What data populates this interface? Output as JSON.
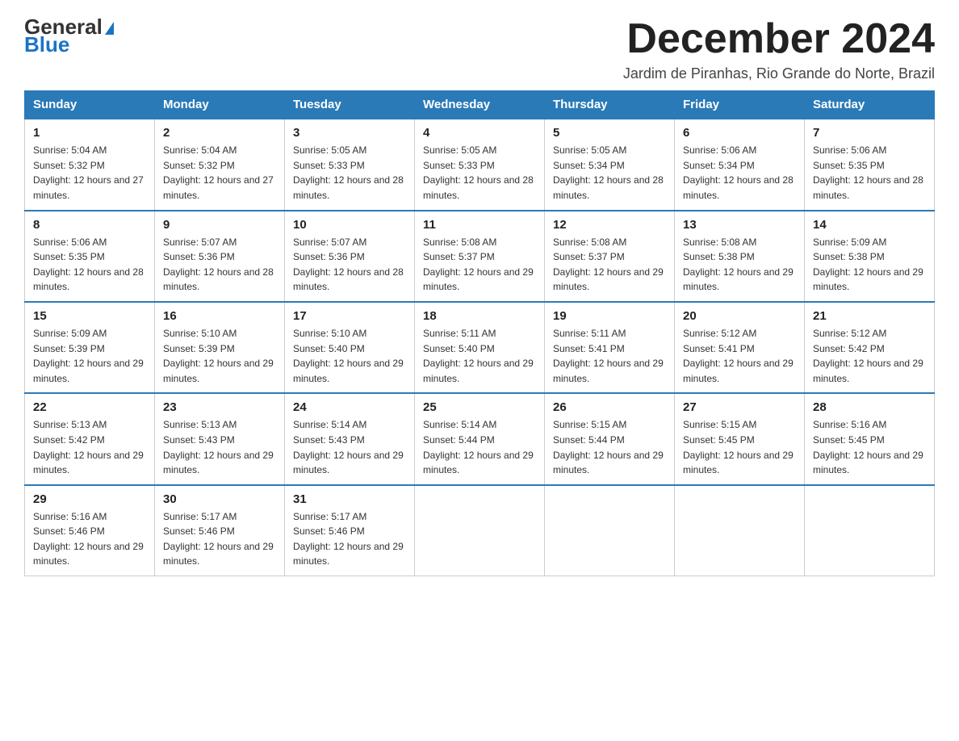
{
  "logo": {
    "general": "General",
    "blue": "Blue",
    "triangle": "▶"
  },
  "header": {
    "month_title": "December 2024",
    "location": "Jardim de Piranhas, Rio Grande do Norte, Brazil"
  },
  "days_of_week": [
    "Sunday",
    "Monday",
    "Tuesday",
    "Wednesday",
    "Thursday",
    "Friday",
    "Saturday"
  ],
  "weeks": [
    [
      {
        "day": "1",
        "sunrise": "5:04 AM",
        "sunset": "5:32 PM",
        "daylight": "12 hours and 27 minutes."
      },
      {
        "day": "2",
        "sunrise": "5:04 AM",
        "sunset": "5:32 PM",
        "daylight": "12 hours and 27 minutes."
      },
      {
        "day": "3",
        "sunrise": "5:05 AM",
        "sunset": "5:33 PM",
        "daylight": "12 hours and 28 minutes."
      },
      {
        "day": "4",
        "sunrise": "5:05 AM",
        "sunset": "5:33 PM",
        "daylight": "12 hours and 28 minutes."
      },
      {
        "day": "5",
        "sunrise": "5:05 AM",
        "sunset": "5:34 PM",
        "daylight": "12 hours and 28 minutes."
      },
      {
        "day": "6",
        "sunrise": "5:06 AM",
        "sunset": "5:34 PM",
        "daylight": "12 hours and 28 minutes."
      },
      {
        "day": "7",
        "sunrise": "5:06 AM",
        "sunset": "5:35 PM",
        "daylight": "12 hours and 28 minutes."
      }
    ],
    [
      {
        "day": "8",
        "sunrise": "5:06 AM",
        "sunset": "5:35 PM",
        "daylight": "12 hours and 28 minutes."
      },
      {
        "day": "9",
        "sunrise": "5:07 AM",
        "sunset": "5:36 PM",
        "daylight": "12 hours and 28 minutes."
      },
      {
        "day": "10",
        "sunrise": "5:07 AM",
        "sunset": "5:36 PM",
        "daylight": "12 hours and 28 minutes."
      },
      {
        "day": "11",
        "sunrise": "5:08 AM",
        "sunset": "5:37 PM",
        "daylight": "12 hours and 29 minutes."
      },
      {
        "day": "12",
        "sunrise": "5:08 AM",
        "sunset": "5:37 PM",
        "daylight": "12 hours and 29 minutes."
      },
      {
        "day": "13",
        "sunrise": "5:08 AM",
        "sunset": "5:38 PM",
        "daylight": "12 hours and 29 minutes."
      },
      {
        "day": "14",
        "sunrise": "5:09 AM",
        "sunset": "5:38 PM",
        "daylight": "12 hours and 29 minutes."
      }
    ],
    [
      {
        "day": "15",
        "sunrise": "5:09 AM",
        "sunset": "5:39 PM",
        "daylight": "12 hours and 29 minutes."
      },
      {
        "day": "16",
        "sunrise": "5:10 AM",
        "sunset": "5:39 PM",
        "daylight": "12 hours and 29 minutes."
      },
      {
        "day": "17",
        "sunrise": "5:10 AM",
        "sunset": "5:40 PM",
        "daylight": "12 hours and 29 minutes."
      },
      {
        "day": "18",
        "sunrise": "5:11 AM",
        "sunset": "5:40 PM",
        "daylight": "12 hours and 29 minutes."
      },
      {
        "day": "19",
        "sunrise": "5:11 AM",
        "sunset": "5:41 PM",
        "daylight": "12 hours and 29 minutes."
      },
      {
        "day": "20",
        "sunrise": "5:12 AM",
        "sunset": "5:41 PM",
        "daylight": "12 hours and 29 minutes."
      },
      {
        "day": "21",
        "sunrise": "5:12 AM",
        "sunset": "5:42 PM",
        "daylight": "12 hours and 29 minutes."
      }
    ],
    [
      {
        "day": "22",
        "sunrise": "5:13 AM",
        "sunset": "5:42 PM",
        "daylight": "12 hours and 29 minutes."
      },
      {
        "day": "23",
        "sunrise": "5:13 AM",
        "sunset": "5:43 PM",
        "daylight": "12 hours and 29 minutes."
      },
      {
        "day": "24",
        "sunrise": "5:14 AM",
        "sunset": "5:43 PM",
        "daylight": "12 hours and 29 minutes."
      },
      {
        "day": "25",
        "sunrise": "5:14 AM",
        "sunset": "5:44 PM",
        "daylight": "12 hours and 29 minutes."
      },
      {
        "day": "26",
        "sunrise": "5:15 AM",
        "sunset": "5:44 PM",
        "daylight": "12 hours and 29 minutes."
      },
      {
        "day": "27",
        "sunrise": "5:15 AM",
        "sunset": "5:45 PM",
        "daylight": "12 hours and 29 minutes."
      },
      {
        "day": "28",
        "sunrise": "5:16 AM",
        "sunset": "5:45 PM",
        "daylight": "12 hours and 29 minutes."
      }
    ],
    [
      {
        "day": "29",
        "sunrise": "5:16 AM",
        "sunset": "5:46 PM",
        "daylight": "12 hours and 29 minutes."
      },
      {
        "day": "30",
        "sunrise": "5:17 AM",
        "sunset": "5:46 PM",
        "daylight": "12 hours and 29 minutes."
      },
      {
        "day": "31",
        "sunrise": "5:17 AM",
        "sunset": "5:46 PM",
        "daylight": "12 hours and 29 minutes."
      },
      null,
      null,
      null,
      null
    ]
  ]
}
